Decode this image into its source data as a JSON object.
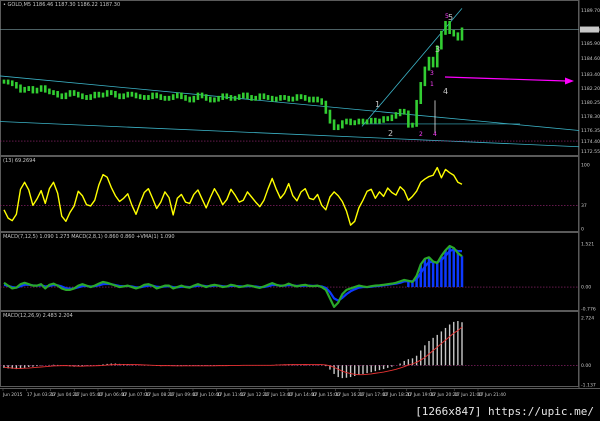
{
  "main_header": "• GOLD,M5  1186.46 1187.30 1186.22 1187.30",
  "stoch_header": "(13) 69.2694",
  "macd1_header": "MACD(7,12,5) 1.090 1.273  MACD(2,8,1) 0.860 0.860  +VMA(1) 1.090",
  "macd2_header": "MACD(12,26,9) 2.483 2.204",
  "watermark": "[1266x847] https://upic.me/",
  "icons": {
    "current_price_marker": "price-tag",
    "buy_arrow": "magenta-arrow"
  },
  "colors": {
    "price_candles": "#32cd32",
    "trendlines": "#3cb4c8",
    "stochastic": "#ffff00",
    "macd_fast": "#2aa82a",
    "macd_slow": "#0d39ff",
    "macd_hist": "#c8c8c8",
    "signal": "#e83232",
    "arrow": "#ff00ff",
    "wave_labels": "#c8c8c8",
    "magenta_labels": "#ff40ff"
  },
  "chart_data": [
    {
      "type": "line",
      "pane": "price",
      "title": "GOLD,M5",
      "ylim": [
        1172.5,
        1189.7
      ],
      "y_ticks": [
        "1189.70",
        "1187.30",
        "1185.90",
        "1184.60",
        "1183.40",
        "1182.20",
        "1180.25",
        "1178.30",
        "1176.35",
        "1174.40",
        "1172.55"
      ],
      "current_price_label": "1187.30",
      "x_ticks": [
        "Jun 2015",
        "17 Jun 03:20",
        "17 Jun 04:20",
        "17 Jun 05:40",
        "17 Jun 06:40",
        "17 Jun 07:00",
        "17 Jun 08:20",
        "17 Jun 09:40",
        "17 Jun 10:40",
        "17 Jun 11:40",
        "17 Jun 12:20",
        "17 Jun 13:40",
        "17 Jun 14:40",
        "17 Jun 15:00",
        "17 Jun 16:20",
        "17 Jun 17:40",
        "17 Jun 18:20",
        "17 Jun 19:00",
        "17 Jun 20:20",
        "17 Jun 21:00",
        "17 Jun 21:40"
      ],
      "wave_labels": [
        "1",
        "2",
        "3",
        "4",
        "5"
      ],
      "magenta_wave_labels": [
        "2",
        "4",
        "1",
        "3",
        "5"
      ],
      "y": [
        1180.9,
        1180.8,
        1180.6,
        1180.3,
        1179.8,
        1180.0,
        1180.1,
        1179.7,
        1179.9,
        1180.2,
        1179.8,
        1179.6,
        1179.5,
        1179.2,
        1179.0,
        1179.3,
        1179.6,
        1179.4,
        1179.2,
        1179.0,
        1178.9,
        1179.1,
        1179.4,
        1179.2,
        1179.3,
        1179.6,
        1179.5,
        1179.2,
        1179.0,
        1179.2,
        1179.4,
        1179.3,
        1179.1,
        1179.0,
        1178.9,
        1179.0,
        1179.3,
        1179.1,
        1178.9,
        1178.8,
        1178.9,
        1179.1,
        1179.3,
        1179.0,
        1178.8,
        1178.6,
        1178.9,
        1179.3,
        1179.1,
        1178.8,
        1178.6,
        1178.7,
        1178.9,
        1179.2,
        1179.0,
        1178.8,
        1178.9,
        1179.1,
        1179.3,
        1179.0,
        1178.8,
        1178.9,
        1179.2,
        1179.0,
        1178.9,
        1178.7,
        1178.8,
        1179.0,
        1178.9,
        1178.7,
        1178.8,
        1179.1,
        1179.0,
        1178.8,
        1178.6,
        1178.8,
        1178.6,
        1178.3,
        1177.2,
        1176.0,
        1175.2,
        1175.4,
        1175.9,
        1176.1,
        1175.8,
        1175.9,
        1176.1,
        1175.9,
        1176.0,
        1176.2,
        1176.0,
        1176.1,
        1176.4,
        1176.3,
        1176.6,
        1176.9,
        1177.3,
        1177.1,
        1175.5,
        1175.6,
        1178.4,
        1180.6,
        1182.5,
        1183.7,
        1182.9,
        1185.1,
        1186.9,
        1188.1,
        1187.0,
        1186.7,
        1186.2,
        1187.3
      ]
    },
    {
      "type": "line",
      "pane": "stochastic",
      "title": "(13) 69.2694",
      "ylim": [
        0,
        100
      ],
      "y_ticks": [
        "100",
        "37",
        "0"
      ],
      "y": [
        30,
        17,
        13,
        23,
        62,
        73,
        61,
        37,
        47,
        60,
        40,
        63,
        73,
        56,
        20,
        12,
        26,
        36,
        59,
        52,
        38,
        36,
        45,
        69,
        85,
        81,
        65,
        52,
        43,
        48,
        55,
        37,
        23,
        41,
        57,
        63,
        48,
        32,
        42,
        58,
        49,
        22,
        48,
        54,
        42,
        40,
        54,
        61,
        47,
        33,
        49,
        63,
        52,
        38,
        46,
        62,
        53,
        42,
        45,
        58,
        50,
        42,
        35,
        45,
        63,
        79,
        62,
        48,
        56,
        71,
        52,
        44,
        58,
        63,
        48,
        46,
        54,
        37,
        30,
        50,
        58,
        52,
        43,
        28,
        6,
        12,
        33,
        45,
        59,
        62,
        48,
        58,
        51,
        64,
        57,
        53,
        66,
        60,
        45,
        51,
        59,
        73,
        78,
        82,
        84,
        96,
        80,
        93,
        88,
        84,
        73,
        70
      ]
    },
    {
      "type": "line",
      "pane": "macd_fast",
      "title": "MACD(7,12,5) 1.090 1.273",
      "ylim": [
        -0.776,
        1.521
      ],
      "y_ticks": [
        "1.521",
        "0.00",
        "-0.776"
      ],
      "series": [
        {
          "name": "MACD(2,8,1)",
          "values": [
            0.15,
            0.05,
            -0.05,
            -0.02,
            0.1,
            0.15,
            0.1,
            0.05,
            0.05,
            0.1,
            -0.05,
            0.08,
            0.12,
            0.05,
            -0.05,
            -0.1,
            -0.1,
            -0.05,
            0.05,
            0.1,
            0.05,
            0.0,
            0.05,
            0.12,
            0.18,
            0.15,
            0.1,
            0.05,
            0.0,
            0.02,
            0.05,
            0.0,
            -0.05,
            0.0,
            0.08,
            0.1,
            0.05,
            -0.05,
            0.0,
            0.05,
            0.05,
            -0.05,
            0.0,
            0.05,
            0.0,
            -0.02,
            0.05,
            0.1,
            0.05,
            0.0,
            0.05,
            0.08,
            0.05,
            0.0,
            0.02,
            0.08,
            0.05,
            0.0,
            0.02,
            0.06,
            0.04,
            0.0,
            -0.03,
            0.02,
            0.08,
            0.14,
            0.08,
            0.04,
            0.06,
            0.12,
            0.06,
            0.02,
            0.06,
            0.08,
            0.04,
            0.03,
            0.05,
            0.0,
            -0.1,
            -0.4,
            -0.7,
            -0.55,
            -0.25,
            -0.1,
            -0.05,
            0.0,
            0.05,
            0.02,
            0.0,
            0.03,
            0.05,
            0.06,
            0.08,
            0.1,
            0.12,
            0.15,
            0.2,
            0.25,
            0.22,
            0.18,
            0.4,
            0.8,
            1.0,
            1.05,
            0.9,
            0.85,
            1.1,
            1.3,
            1.45,
            1.38,
            1.2,
            1.09
          ]
        },
        {
          "name": "+VMA(1)",
          "values": [
            0.08,
            0.04,
            0.0,
            -0.02,
            0.03,
            0.08,
            0.08,
            0.06,
            0.05,
            0.06,
            0.02,
            0.04,
            0.07,
            0.06,
            0.02,
            -0.04,
            -0.06,
            -0.05,
            -0.01,
            0.03,
            0.04,
            0.02,
            0.03,
            0.06,
            0.1,
            0.11,
            0.1,
            0.07,
            0.04,
            0.03,
            0.04,
            0.02,
            -0.01,
            -0.01,
            0.02,
            0.05,
            0.05,
            0.01,
            0.0,
            0.02,
            0.03,
            0.0,
            -0.01,
            0.01,
            0.01,
            0.0,
            0.02,
            0.05,
            0.05,
            0.03,
            0.03,
            0.05,
            0.05,
            0.03,
            0.02,
            0.04,
            0.04,
            0.03,
            0.02,
            0.03,
            0.03,
            0.02,
            0.0,
            0.0,
            0.03,
            0.07,
            0.07,
            0.05,
            0.05,
            0.07,
            0.06,
            0.04,
            0.04,
            0.05,
            0.05,
            0.04,
            0.04,
            0.02,
            -0.03,
            -0.18,
            -0.4,
            -0.48,
            -0.38,
            -0.25,
            -0.15,
            -0.08,
            -0.02,
            0.0,
            0.0,
            0.01,
            0.03,
            0.04,
            0.06,
            0.08,
            0.1,
            0.12,
            0.15,
            0.2,
            0.21,
            0.2,
            0.28,
            0.5,
            0.72,
            0.88,
            0.89,
            0.87,
            0.95,
            1.1,
            1.27,
            1.33,
            1.27,
            1.27
          ]
        }
      ]
    },
    {
      "type": "bar",
      "pane": "macd_hist",
      "title": "MACD(12,26,9) 2.483 2.204",
      "ylim": [
        -1.137,
        2.724
      ],
      "y_ticks": [
        "2.724",
        "0.00",
        "-1.137"
      ],
      "series": [
        {
          "name": "MACD(12,26,9)",
          "values": [
            -0.15,
            -0.18,
            -0.2,
            -0.22,
            -0.2,
            -0.15,
            -0.1,
            -0.08,
            -0.05,
            -0.02,
            0.0,
            0.02,
            0.03,
            0.02,
            0.0,
            -0.03,
            -0.06,
            -0.08,
            -0.07,
            -0.05,
            -0.03,
            -0.01,
            0.0,
            0.02,
            0.05,
            0.08,
            0.1,
            0.1,
            0.08,
            0.06,
            0.05,
            0.03,
            0.01,
            -0.01,
            -0.02,
            -0.02,
            -0.02,
            -0.04,
            -0.05,
            -0.04,
            -0.03,
            -0.04,
            -0.05,
            -0.05,
            -0.04,
            -0.04,
            -0.03,
            -0.02,
            -0.02,
            -0.03,
            -0.03,
            -0.02,
            -0.01,
            -0.01,
            -0.01,
            0.0,
            0.01,
            0.01,
            0.0,
            0.0,
            0.01,
            0.01,
            0.0,
            -0.01,
            0.0,
            0.02,
            0.04,
            0.05,
            0.05,
            0.06,
            0.06,
            0.05,
            0.05,
            0.05,
            0.04,
            0.03,
            0.03,
            0.02,
            -0.05,
            -0.25,
            -0.5,
            -0.68,
            -0.74,
            -0.72,
            -0.68,
            -0.62,
            -0.55,
            -0.5,
            -0.45,
            -0.4,
            -0.34,
            -0.28,
            -0.22,
            -0.15,
            -0.08,
            0.0,
            0.1,
            0.25,
            0.35,
            0.4,
            0.55,
            0.85,
            1.15,
            1.4,
            1.58,
            1.75,
            1.95,
            2.15,
            2.35,
            2.5,
            2.55,
            2.48
          ]
        },
        {
          "name": "Signal",
          "values": [
            -0.12,
            -0.14,
            -0.16,
            -0.18,
            -0.18,
            -0.17,
            -0.16,
            -0.14,
            -0.12,
            -0.1,
            -0.08,
            -0.06,
            -0.04,
            -0.03,
            -0.02,
            -0.02,
            -0.03,
            -0.04,
            -0.05,
            -0.05,
            -0.04,
            -0.04,
            -0.03,
            -0.02,
            -0.01,
            0.01,
            0.03,
            0.04,
            0.05,
            0.05,
            0.05,
            0.05,
            0.04,
            0.03,
            0.02,
            0.01,
            0.0,
            -0.01,
            -0.02,
            -0.02,
            -0.02,
            -0.03,
            -0.03,
            -0.03,
            -0.03,
            -0.03,
            -0.03,
            -0.03,
            -0.03,
            -0.03,
            -0.03,
            -0.03,
            -0.02,
            -0.02,
            -0.02,
            -0.01,
            -0.01,
            -0.01,
            0.0,
            0.0,
            0.0,
            0.0,
            0.0,
            0.0,
            0.0,
            0.0,
            0.01,
            0.02,
            0.03,
            0.03,
            0.04,
            0.04,
            0.04,
            0.05,
            0.04,
            0.04,
            0.04,
            0.04,
            0.02,
            -0.03,
            -0.12,
            -0.23,
            -0.34,
            -0.42,
            -0.48,
            -0.52,
            -0.54,
            -0.54,
            -0.52,
            -0.5,
            -0.46,
            -0.43,
            -0.39,
            -0.34,
            -0.29,
            -0.23,
            -0.16,
            -0.08,
            0.01,
            0.08,
            0.17,
            0.3,
            0.45,
            0.65,
            0.85,
            1.05,
            1.25,
            1.45,
            1.65,
            1.85,
            2.0,
            2.2
          ]
        }
      ]
    }
  ]
}
